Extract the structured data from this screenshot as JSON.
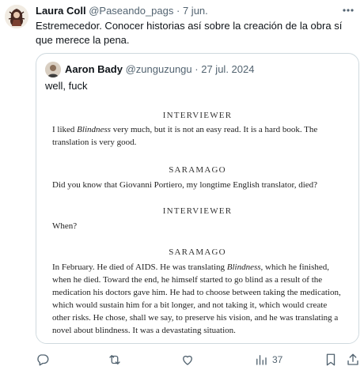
{
  "tweet": {
    "author_name": "Laura Coll",
    "author_handle": "@Paseando_pags",
    "separator": "·",
    "date": "7 jun.",
    "text": "Estremecedor. Conocer historias así sobre la creación de la obra sí que merece la pena."
  },
  "quoted_tweet": {
    "author_name": "Aaron Bady",
    "author_handle": "@zunguzungu",
    "separator": "·",
    "date": "27 jul. 2024",
    "text": "well, fuck",
    "image": {
      "blocks": [
        {
          "speaker": "INTERVIEWER"
        },
        {
          "before": "I liked ",
          "em": "Blindness",
          "after": " very much, but it is not an easy read. It is a hard book. The translation is very good."
        },
        {
          "speaker": "SARAMAGO"
        },
        {
          "text": "Did you know that Giovanni Portiero, my longtime English translator, died?"
        },
        {
          "speaker": "INTERVIEWER"
        },
        {
          "text": "When?"
        },
        {
          "speaker": "SARAMAGO"
        },
        {
          "before": "In February. He died of AIDS. He was translating ",
          "em": "Blindness",
          "after": ", which he finished, when he died. Toward the end, he himself started to go blind as a result of the medication his doctors gave him. He had to choose between taking the medication, which would sustain him for a bit longer, and not taking it, which would create other risks. He chose, shall we say, to preserve his vision, and he was translating a novel about blindness. It was a devastating situation."
        }
      ]
    }
  },
  "actions": {
    "reply_icon": "reply-icon",
    "retweet_icon": "retweet-icon",
    "like_icon": "heart-icon",
    "views_icon": "views-icon",
    "views_count": "37",
    "bookmark_icon": "bookmark-icon",
    "share_icon": "share-icon"
  },
  "colors": {
    "text_primary": "#0f1419",
    "text_secondary": "#536471",
    "border": "#cfd9de"
  }
}
